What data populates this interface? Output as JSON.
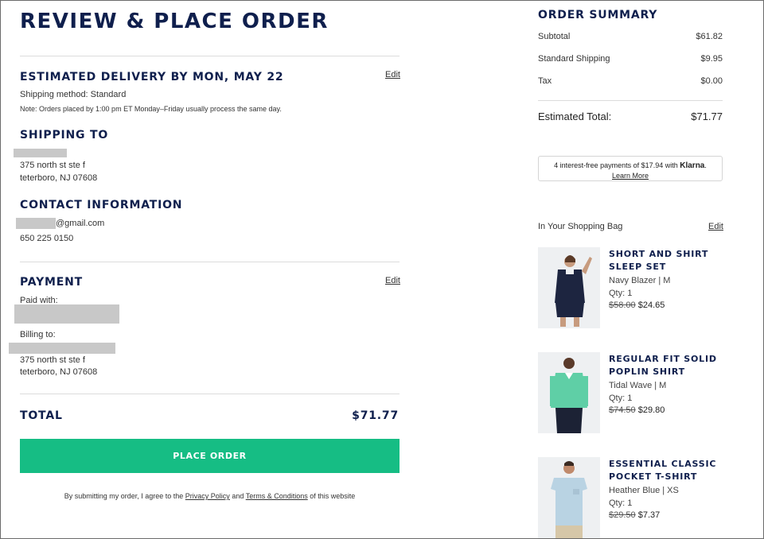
{
  "page": {
    "title": "REVIEW & PLACE ORDER"
  },
  "delivery": {
    "heading": "ESTIMATED DELIVERY BY MON, MAY 22",
    "edit_label": "Edit",
    "shipping_method": "Shipping method: Standard",
    "note": "Note: Orders placed by 1:00 pm ET Monday–Friday usually process the same day."
  },
  "shipping_to": {
    "heading": "SHIPPING TO",
    "address_line1": "375 north st ste f",
    "address_line2": "teterboro, NJ 07608"
  },
  "contact": {
    "heading": "CONTACT INFORMATION",
    "email_suffix": "@gmail.com",
    "phone": "650 225 0150"
  },
  "payment": {
    "heading": "PAYMENT",
    "edit_label": "Edit",
    "paid_with_label": "Paid with:",
    "billing_to_label": "Billing to:",
    "billing_line1": "375 north st ste f",
    "billing_line2": "teterboro, NJ 07608"
  },
  "total": {
    "label": "TOTAL",
    "value": "$71.77"
  },
  "place_order": {
    "label": "PLACE ORDER"
  },
  "legal": {
    "prefix": "By submitting my order, I agree to the",
    "privacy": "Privacy Policy",
    "and": "and",
    "terms": "Terms & Conditions",
    "suffix": "of this website"
  },
  "summary": {
    "heading": "ORDER SUMMARY",
    "subtotal_label": "Subtotal",
    "subtotal_value": "$61.82",
    "shipping_label": "Standard Shipping",
    "shipping_value": "$9.95",
    "tax_label": "Tax",
    "tax_value": "$0.00",
    "total_label": "Estimated Total:",
    "total_value": "$71.77"
  },
  "klarna": {
    "text": "4 interest-free payments of $17.94 with",
    "brand": "Klarna",
    "learn_more": "Learn More"
  },
  "bag": {
    "heading": "In Your Shopping Bag",
    "edit_label": "Edit",
    "items": [
      {
        "name": "SHORT AND SHIRT SLEEP SET",
        "variant": "Navy Blazer  |  M",
        "qty": "Qty: 1",
        "old_price": "$58.00",
        "price": "$24.65"
      },
      {
        "name": "REGULAR FIT SOLID POPLIN SHIRT",
        "variant": "Tidal Wave  |  M",
        "qty": "Qty: 1",
        "old_price": "$74.50",
        "price": "$29.80"
      },
      {
        "name": "ESSENTIAL CLASSIC POCKET T-SHIRT",
        "variant": "Heather Blue  |  XS",
        "qty": "Qty: 1",
        "old_price": "$29.50",
        "price": "$7.37"
      }
    ]
  },
  "colors": {
    "navy": "#0f1f4d",
    "accent_green": "#16bd84",
    "redaction_gray": "#c8c8c8"
  }
}
